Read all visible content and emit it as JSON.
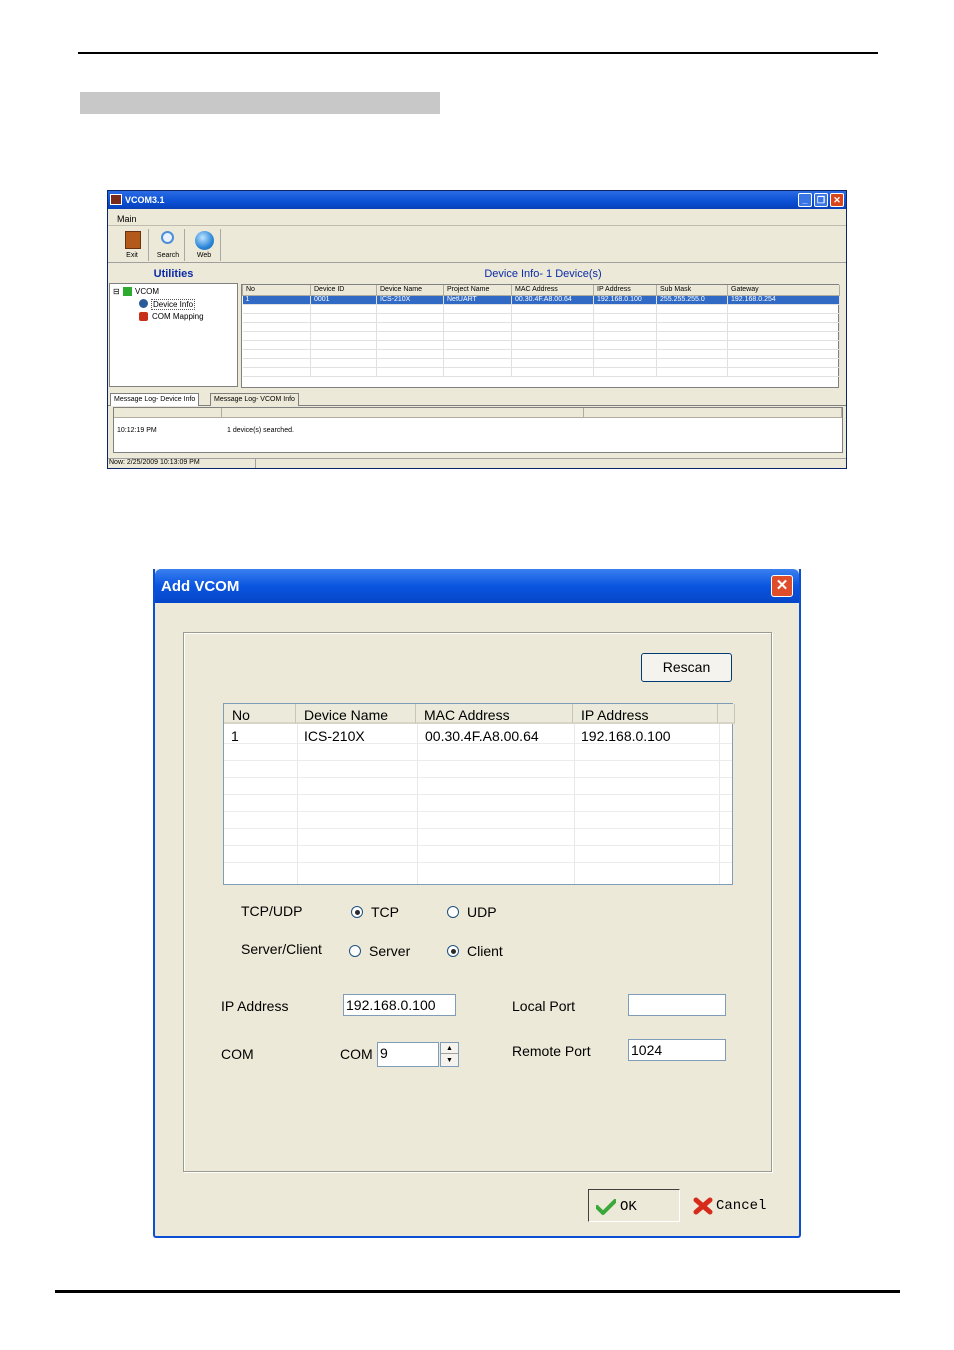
{
  "vcom_window": {
    "title": "VCOM3.1",
    "menu": [
      "Main"
    ],
    "toolbar": [
      {
        "label": "Exit",
        "icon": "exit-door-icon"
      },
      {
        "label": "Search",
        "icon": "magnifier-icon"
      },
      {
        "label": "Web",
        "icon": "globe-icon"
      }
    ],
    "utilities_heading": "Utilities",
    "tree": {
      "root": "VCOM",
      "children": [
        "Device Info",
        "COM Mapping"
      ]
    },
    "device_info_heading": "Device Info- 1 Device(s)",
    "columns": [
      "No",
      "Device ID",
      "Device Name",
      "Project Name",
      "MAC Address",
      "IP Address",
      "Sub Mask",
      "Gateway"
    ],
    "rows": [
      [
        "1",
        "0001",
        "ICS-210X",
        "NetUART",
        "00.30.4F.A8.00.64",
        "192.168.0.100",
        "255.255.255.0",
        "192.168.0.254"
      ]
    ],
    "log_tabs": [
      "Message Log- Device Info",
      "Message Log- VCOM Info"
    ],
    "log_entries": [
      {
        "time": "10:12:19 PM",
        "message": "1 device(s) searched."
      }
    ],
    "status": "Now: 2/25/2009 10:13:09 PM"
  },
  "add_vcom_dialog": {
    "title": "Add VCOM",
    "rescan_label": "Rescan",
    "columns": [
      "No",
      "Device Name",
      "MAC Address",
      "IP Address"
    ],
    "rows": [
      [
        "1",
        "ICS-210X",
        "00.30.4F.A8.00.64",
        "192.168.0.100"
      ]
    ],
    "tcp_udp": {
      "label": "TCP/UDP",
      "options": [
        "TCP",
        "UDP"
      ],
      "selected": "TCP"
    },
    "server_client": {
      "label": "Server/Client",
      "options": [
        "Server",
        "Client"
      ],
      "selected": "Client"
    },
    "ip_address": {
      "label": "IP Address",
      "value": "192.168.0.100"
    },
    "local_port": {
      "label": "Local Port",
      "value": ""
    },
    "com": {
      "label": "COM",
      "prefix": "COM",
      "value": "9"
    },
    "remote_port": {
      "label": "Remote Port",
      "value": "1024"
    },
    "ok_label": "OK",
    "cancel_label": "Cancel"
  },
  "colors": {
    "xp_title_blue": "#0a55e0",
    "selection_blue": "#316ac5",
    "heading_blue": "#0a2aa8",
    "dialog_face": "#ece9d8"
  }
}
